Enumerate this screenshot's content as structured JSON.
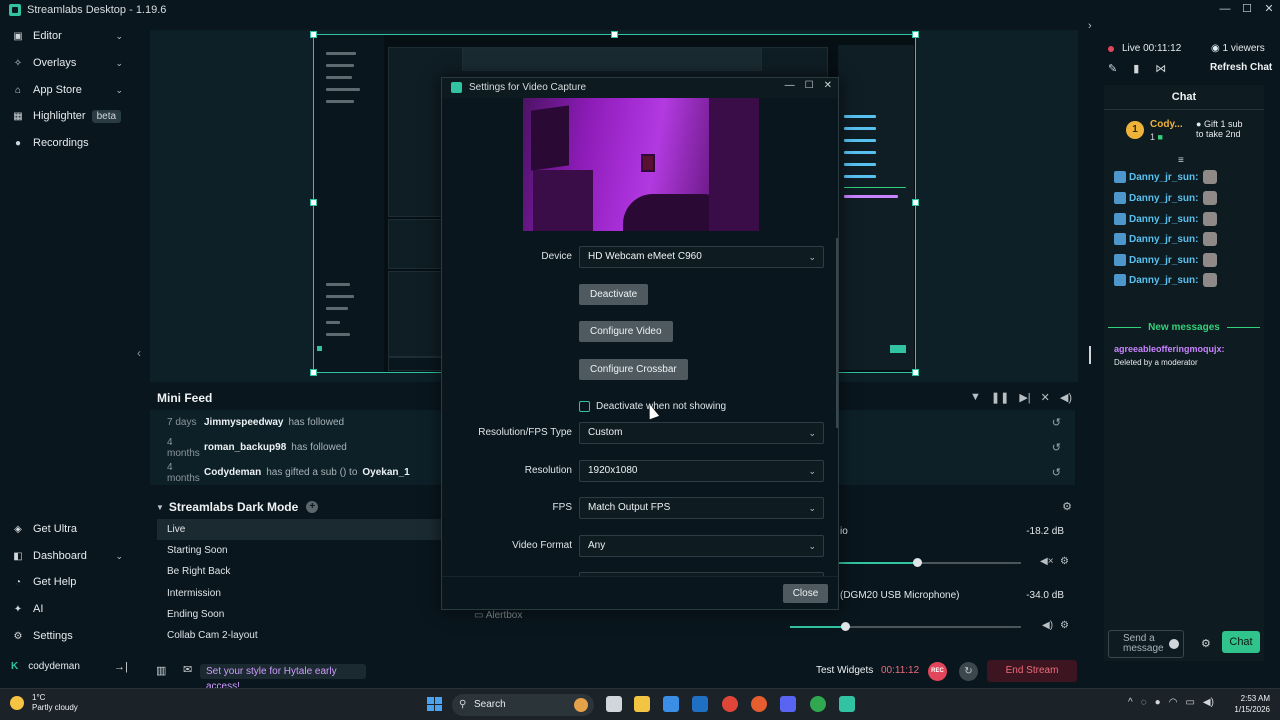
{
  "window": {
    "title": "Streamlabs Desktop - 1.19.6",
    "minimize": "—",
    "maximize": "☐",
    "close": "✕"
  },
  "sidebar": {
    "items": [
      {
        "label": "Editor",
        "icon": "editor-icon"
      },
      {
        "label": "Overlays",
        "icon": "overlays-icon"
      },
      {
        "label": "App Store",
        "icon": "store-icon"
      },
      {
        "label": "Highlighter",
        "icon": "highlighter-icon",
        "badge": "beta"
      },
      {
        "label": "Recordings",
        "icon": "recordings-icon"
      }
    ],
    "bottom_items": [
      {
        "label": "Get Ultra",
        "icon": "ultra-icon"
      },
      {
        "label": "Dashboard",
        "icon": "dashboard-icon"
      },
      {
        "label": "Get Help",
        "icon": "help-icon"
      },
      {
        "label": "AI",
        "icon": "ai-icon"
      },
      {
        "label": "Settings",
        "icon": "settings-icon"
      }
    ],
    "user": "codydeman"
  },
  "minifeed": {
    "title": "Mini Feed",
    "events": [
      {
        "when": "7 days",
        "who": "Jimmyspeedway",
        "what": "has followed",
        "target": ""
      },
      {
        "when": "4 months",
        "who": "roman_backup98",
        "what": "has followed",
        "target": ""
      },
      {
        "when": "4 months",
        "who": "Codydeman",
        "what": "has gifted a sub () to",
        "target": "Oyekan_1"
      }
    ]
  },
  "scenes": {
    "title": "Streamlabs Dark Mode",
    "items": [
      "Live",
      "Starting Soon",
      "Be Right Back",
      "Intermission",
      "Ending Soon",
      "Collab Cam 2-layout"
    ],
    "active": "Live"
  },
  "sources": {
    "partial_label": "Alertbox"
  },
  "mixer": {
    "channels": [
      {
        "name": "io",
        "db": "-18.2 dB",
        "level": 0.55
      },
      {
        "name": "(DGM20 USB Microphone)",
        "db": "-34.0 dB",
        "level": 0.24
      }
    ]
  },
  "stream": {
    "live_label": "Live 00:11:12",
    "viewers": "1 viewers",
    "refresh_chat": "Refresh Chat"
  },
  "chat": {
    "title": "Chat",
    "pinned": {
      "rank": "1",
      "name": "Cody...",
      "count": "1",
      "gift_text": "Gift 1 sub to take 2nd"
    },
    "messages": [
      "Danny_jr_sun:",
      "Danny_jr_sun:",
      "Danny_jr_sun:",
      "Danny_jr_sun:",
      "Danny_jr_sun:",
      "Danny_jr_sun:"
    ],
    "new_messages": "New messages",
    "deleted_user": "agreeableofferingmoqujx:",
    "deleted_text": "Deleted by a moderator",
    "send_placeholder": "Send a message",
    "chat_button": "Chat"
  },
  "statusbar": {
    "promo": "Set your style for Hytale early access!",
    "test_widgets": "Test Widgets",
    "timer": "00:11:12",
    "rec": "REC",
    "end_stream": "End Stream"
  },
  "modal": {
    "title": "Settings for Video Capture",
    "fields": {
      "device_label": "Device",
      "device_value": "HD Webcam eMeet C960",
      "deactivate": "Deactivate",
      "configure_video": "Configure Video",
      "configure_crossbar": "Configure Crossbar",
      "deactivate_check": "Deactivate when not showing",
      "resfps_label": "Resolution/FPS Type",
      "resfps_value": "Custom",
      "resolution_label": "Resolution",
      "resolution_value": "1920x1080",
      "fps_label": "FPS",
      "fps_value": "Match Output FPS",
      "format_label": "Video Format",
      "format_value": "Any"
    },
    "close": "Close"
  },
  "taskbar": {
    "temp": "1°C",
    "weather": "Partly cloudy",
    "search": "Search",
    "time": "2:53 AM",
    "date": "1/15/2026"
  },
  "colors": {
    "accent": "#31c3a2",
    "live_red": "#e1465b",
    "chat_green": "#33d17a",
    "username_blue": "#58c1f0"
  }
}
